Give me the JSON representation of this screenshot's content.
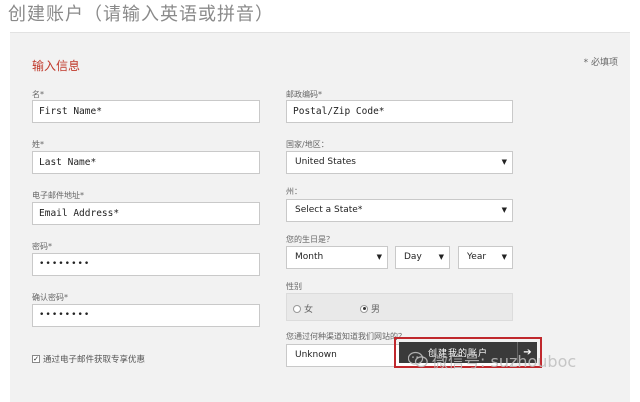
{
  "page_title": "创建账户（请输入英语或拼音）",
  "form": {
    "section_title": "输入信息",
    "required_note": "* 必填项",
    "first_name": {
      "label": "名*",
      "value": "First Name*"
    },
    "last_name": {
      "label": "姓*",
      "value": "Last Name*"
    },
    "email": {
      "label": "电子邮件地址*",
      "value": "Email Address*"
    },
    "password": {
      "label": "密码*",
      "value": "••••••••"
    },
    "confirm_password": {
      "label": "确认密码*",
      "value": "••••••••"
    },
    "postal": {
      "label": "邮政编码*",
      "value": "Postal/Zip Code*"
    },
    "country": {
      "label": "国家/地区：",
      "value": "United States"
    },
    "state": {
      "label": "州：",
      "value": "Select a State*"
    },
    "birthday": {
      "label": "您的生日是？",
      "month": "Month",
      "day": "Day",
      "year": "Year"
    },
    "gender": {
      "label": "性别",
      "female": "女",
      "male": "男",
      "selected": "male"
    },
    "referral": {
      "label": "您通过何种渠道知道我们网站的？",
      "value": "Unknown"
    },
    "newsletter": {
      "label": "通过电子邮件获取专享优惠",
      "checked": true
    },
    "submit_label": "创建我的账户",
    "submit_arrow": "➔"
  },
  "watermark": {
    "text": "微信号: suzhouboc"
  },
  "icons": {
    "dropdown": "dropdown-arrow-icon",
    "wechat": "wechat-icon"
  }
}
